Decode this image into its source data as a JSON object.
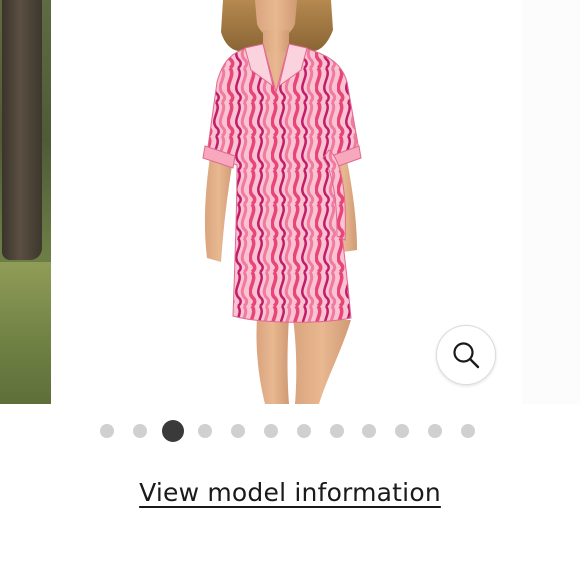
{
  "carousel": {
    "current_slide": 3,
    "slide_count": 12,
    "dots": [
      {
        "active": false
      },
      {
        "active": false
      },
      {
        "active": true
      },
      {
        "active": false
      },
      {
        "active": false
      },
      {
        "active": false
      },
      {
        "active": false
      },
      {
        "active": false
      },
      {
        "active": false
      },
      {
        "active": false
      },
      {
        "active": false
      },
      {
        "active": false
      }
    ]
  },
  "zoom": {
    "icon": "magnifier-icon"
  },
  "model_info": {
    "link_label": "View model information"
  },
  "colors": {
    "dress_base": "#f7a8bd",
    "dress_stripe_pink": "#e8457a",
    "dress_stripe_magenta": "#c21d6a",
    "dot_inactive": "#d0d0d0",
    "dot_active": "#3a3a3a",
    "link_text": "#1a1a1a"
  }
}
